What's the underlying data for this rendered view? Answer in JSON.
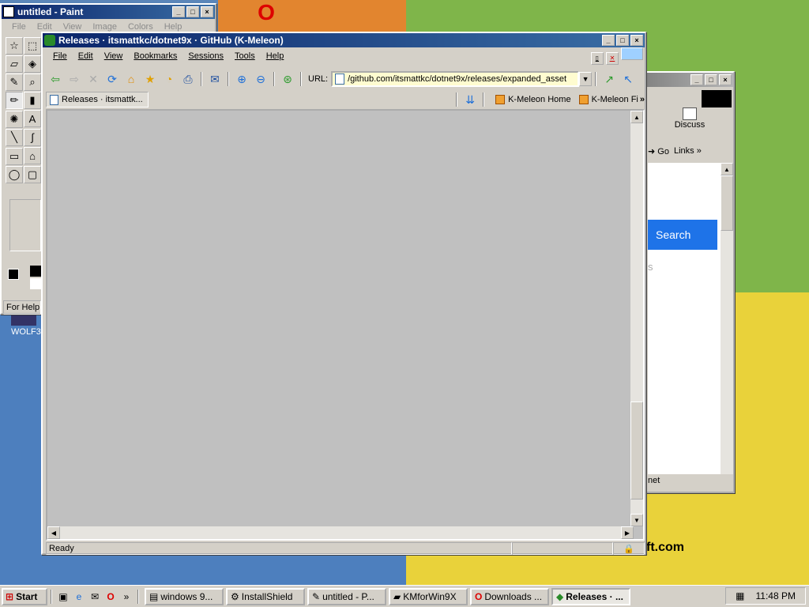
{
  "paint": {
    "title": "untitled - Paint",
    "menu": [
      "File",
      "Edit",
      "View",
      "Image",
      "Colors",
      "Help"
    ],
    "status": "For Help,"
  },
  "desktop": {
    "icon_label": "WOLF3",
    "bg_text": "ft.com"
  },
  "back_window": {
    "toolbar_label": "Discuss",
    "go_label": "Go",
    "links_label": "Links",
    "search_label": "Search",
    "status_text": "net",
    "stray_text": "s"
  },
  "browser": {
    "title": "Releases · itsmattkc/dotnet9x · GitHub (K-Meleon)",
    "menu": [
      "File",
      "Edit",
      "View",
      "Bookmarks",
      "Sessions",
      "Tools",
      "Help"
    ],
    "url_label": "URL:",
    "url": "/github.com/itsmattkc/dotnet9x/releases/expanded_asset",
    "tab_label": "Releases · itsmattk...",
    "bookmarks": [
      "K-Meleon Home",
      "K-Meleon Fi"
    ],
    "status": "Ready"
  },
  "taskbar": {
    "start": "Start",
    "tasks": [
      {
        "label": "windows 9...",
        "active": false
      },
      {
        "label": "InstallShield",
        "active": false
      },
      {
        "label": "untitled - P...",
        "active": false
      },
      {
        "label": "KMforWin9X",
        "active": false
      },
      {
        "label": "Downloads ...",
        "active": false
      },
      {
        "label": "Releases · ...",
        "active": true
      }
    ],
    "clock": "11:48 PM"
  },
  "colors": {
    "title_active": "#0a246a",
    "url_bg": "#fffcd0",
    "search_button": "#1e73e8"
  }
}
